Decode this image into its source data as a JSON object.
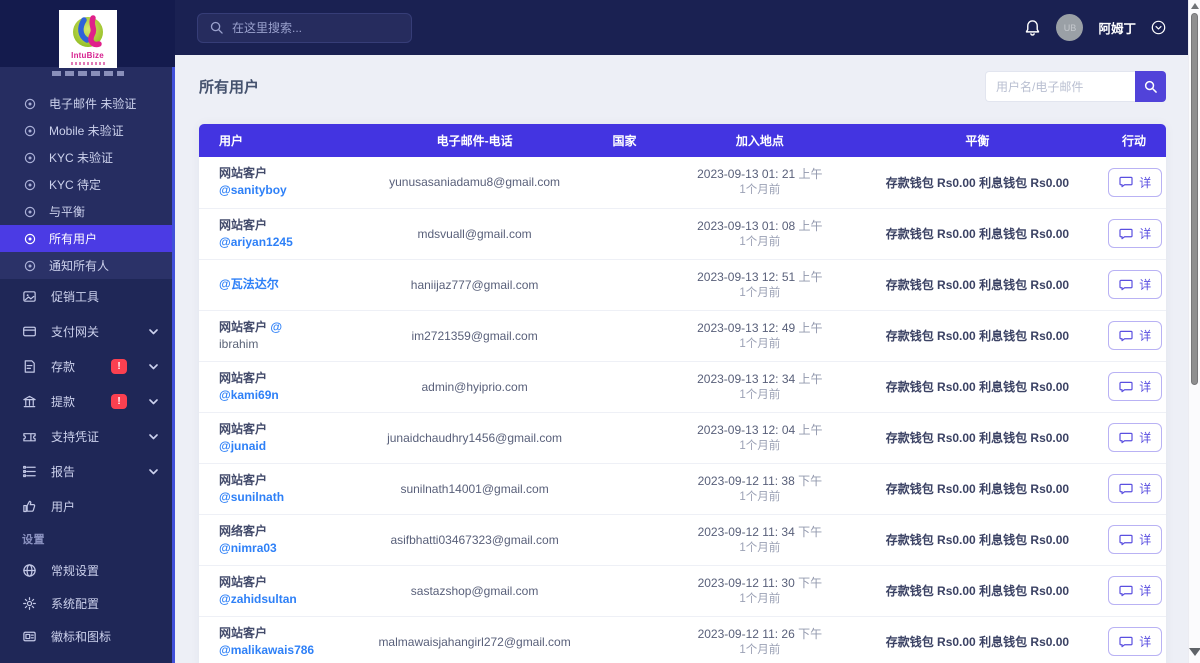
{
  "colors": {
    "topbar_navy": "#1a2152",
    "sidebar_navy": "#1f2757",
    "accent_purple": "#4334e1",
    "active_item_purple": "#4b3be4",
    "link_blue": "#2e80f7",
    "badge_red": "#fb4050",
    "detail_purple": "#5a4fe0"
  },
  "brand": {
    "logo_text": "IntuBize"
  },
  "topbar": {
    "search_placeholder": "在这里搜索...",
    "user_name": "阿姆丁",
    "avatar_initials": "UB"
  },
  "sidebar": {
    "items": [
      {
        "type": "clipped",
        "name": "clipped-item"
      },
      {
        "type": "sub",
        "name": "email-unverified",
        "label": "电子邮件 未验证"
      },
      {
        "type": "sub",
        "name": "mobile-unverified",
        "label": "Mobile 未验证"
      },
      {
        "type": "sub",
        "name": "kyc-unverified",
        "label": "KYC 未验证"
      },
      {
        "type": "sub",
        "name": "kyc-pending",
        "label": "KYC 待定"
      },
      {
        "type": "sub",
        "name": "with-balance",
        "label": "与平衡"
      },
      {
        "type": "sub",
        "name": "all-users",
        "label": "所有用户",
        "active": true
      },
      {
        "type": "sub",
        "name": "notify-all",
        "label": "通知所有人",
        "subtle": true
      },
      {
        "type": "main",
        "name": "promo-tools",
        "label": "促销工具",
        "icon": "image-icon"
      },
      {
        "type": "main",
        "name": "payment-gateways",
        "label": "支付网关",
        "icon": "card-icon",
        "chevron": true
      },
      {
        "type": "main",
        "name": "deposits",
        "label": "存款",
        "icon": "document-icon",
        "badge": "!",
        "chevron": true
      },
      {
        "type": "main",
        "name": "withdrawals",
        "label": "提款",
        "icon": "bank-icon",
        "badge": "!",
        "chevron": true
      },
      {
        "type": "main",
        "name": "support-tickets",
        "label": "支持凭证",
        "icon": "ticket-icon",
        "chevron": true
      },
      {
        "type": "main",
        "name": "reports",
        "label": "报告",
        "icon": "report-icon",
        "chevron": true
      },
      {
        "type": "main",
        "name": "users",
        "label": "用户",
        "icon": "thumbs-up-icon"
      },
      {
        "type": "section",
        "name": "settings-section",
        "label": "设置"
      },
      {
        "type": "main",
        "name": "general-settings",
        "label": "常规设置",
        "icon": "globe-icon",
        "set": true
      },
      {
        "type": "main",
        "name": "system-configuration",
        "label": "系统配置",
        "icon": "gear-icon",
        "set": true
      },
      {
        "type": "main",
        "name": "logo-favicon",
        "label": "徽标和图标",
        "icon": "logo-icon",
        "set": true
      }
    ]
  },
  "main": {
    "title": "所有用户",
    "search_placeholder": "用户名/电子邮件",
    "action_label": "详",
    "table": {
      "headers": [
        "用户",
        "电子邮件-电话",
        "国家",
        "加入地点",
        "平衡",
        "行动"
      ],
      "rows": [
        {
          "label": "网站客户",
          "user": "@sanityboy",
          "user_style": "blue",
          "email": "yunusasaniadamu8@gmail.com",
          "country": "",
          "date": "2023-09-13 01: 21",
          "ampm": "上午",
          "ago": "1个月前",
          "balance": "存款钱包 Rs0.00 利息钱包 Rs0.00"
        },
        {
          "label": "网站客户",
          "user": "@ariyan1245",
          "user_style": "blue",
          "email": "mdsvuall@gmail.com",
          "country": "",
          "date": "2023-09-13 01: 08",
          "ampm": "上午",
          "ago": "1个月前",
          "balance": "存款钱包 Rs0.00 利息钱包 Rs0.00"
        },
        {
          "label": "",
          "user": "@瓦法达尔",
          "user_style": "blue",
          "email": "haniijaz777@gmail.com",
          "country": "",
          "date": "2023-09-13 12: 51",
          "ampm": "上午",
          "ago": "1个月前",
          "balance": "存款钱包 Rs0.00 利息钱包 Rs0.00"
        },
        {
          "label": "网站客户",
          "label_at": true,
          "user": "ibrahim",
          "user_style": "gray",
          "email": "im2721359@gmail.com",
          "country": "",
          "date": "2023-09-13 12: 49",
          "ampm": "上午",
          "ago": "1个月前",
          "balance": "存款钱包 Rs0.00 利息钱包 Rs0.00"
        },
        {
          "label": "网站客户",
          "user": "@kami69n",
          "user_style": "blue",
          "email": "admin@hyiprio.com",
          "country": "",
          "date": "2023-09-13 12: 34",
          "ampm": "上午",
          "ago": "1个月前",
          "balance": "存款钱包 Rs0.00 利息钱包 Rs0.00"
        },
        {
          "label": "网站客户",
          "user": "@junaid",
          "user_style": "blue",
          "email": "junaidchaudhry1456@gmail.com",
          "country": "",
          "date": "2023-09-13 12: 04",
          "ampm": "上午",
          "ago": "1个月前",
          "balance": "存款钱包 Rs0.00 利息钱包 Rs0.00"
        },
        {
          "label": "网站客户",
          "user": "@sunilnath",
          "user_style": "blue",
          "email": "sunilnath14001@gmail.com",
          "country": "",
          "date": "2023-09-12 11: 38",
          "ampm": "下午",
          "ago": "1个月前",
          "balance": "存款钱包 Rs0.00 利息钱包 Rs0.00"
        },
        {
          "label": "网络客户",
          "user": "@nimra03",
          "user_style": "blue",
          "email": "asifbhatti03467323@gmail.com",
          "country": "",
          "date": "2023-09-12 11: 34",
          "ampm": "下午",
          "ago": "1个月前",
          "balance": "存款钱包 Rs0.00 利息钱包 Rs0.00"
        },
        {
          "label": "网站客户",
          "user": "@zahidsultan",
          "user_style": "blue",
          "email": "sastazshop@gmail.com",
          "country": "",
          "date": "2023-09-12 11: 30",
          "ampm": "下午",
          "ago": "1个月前",
          "balance": "存款钱包 Rs0.00 利息钱包 Rs0.00"
        },
        {
          "label": "网站客户",
          "user": "@malikawais786",
          "user_style": "blue",
          "email": "malmawaisjahangirl272@gmail.com",
          "country": "",
          "date": "2023-09-12 11: 26",
          "ampm": "下午",
          "ago": "1个月前",
          "balance": "存款钱包 Rs0.00 利息钱包 Rs0.00"
        }
      ]
    }
  }
}
